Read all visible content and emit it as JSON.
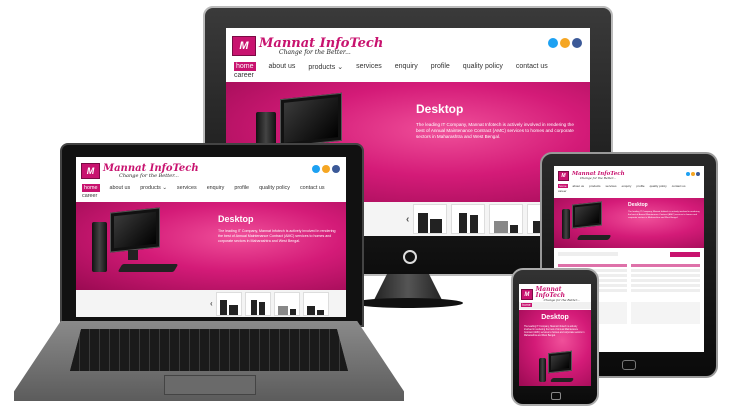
{
  "brand": {
    "name": "Mannat InfoTech",
    "tagline": "Change for the Better..."
  },
  "nav": {
    "items": [
      "home",
      "about us",
      "products",
      "services",
      "enquiry",
      "profile",
      "quality policy",
      "contact us",
      "career"
    ],
    "products_chevron": "⌄"
  },
  "hero": {
    "title": "Desktop",
    "text": "The leading IT Company, Mannat Infotech is actively involved in rendering the best of Annual Maintenance Contract (AMC) services to homes and corporate sectors in Maharashtra and West Bengal."
  },
  "slider": {
    "prev": "‹",
    "next": "›"
  },
  "colors": {
    "accent": "#c8136f",
    "twitter": "#1da1f2",
    "email": "#f5a623",
    "facebook": "#3b5998"
  },
  "icons": [
    "twitter-icon",
    "email-icon",
    "facebook-icon",
    "power-icon",
    "home-icon"
  ]
}
